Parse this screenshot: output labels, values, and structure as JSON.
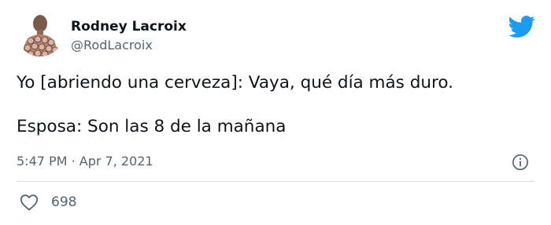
{
  "author": {
    "name": "Rodney Lacroix",
    "handle": "@RodLacroix",
    "avatar_icon": "avatar-photo"
  },
  "tweet": {
    "lines": [
      "Yo [abriendo una cerveza]: Vaya, qué día más duro.",
      "Esposa: Son las 8 de la mañana"
    ],
    "time": "5:47 PM",
    "separator": "·",
    "date": "Apr 7, 2021"
  },
  "engagement": {
    "likes": "698",
    "like_icon": "heart-icon"
  },
  "icons": {
    "brand": "twitter-bird-icon",
    "info": "info-icon"
  },
  "colors": {
    "brand_blue": "#1d9bf0",
    "secondary_text": "#536471",
    "primary_text": "#0f1419",
    "divider": "#d9dee3"
  }
}
